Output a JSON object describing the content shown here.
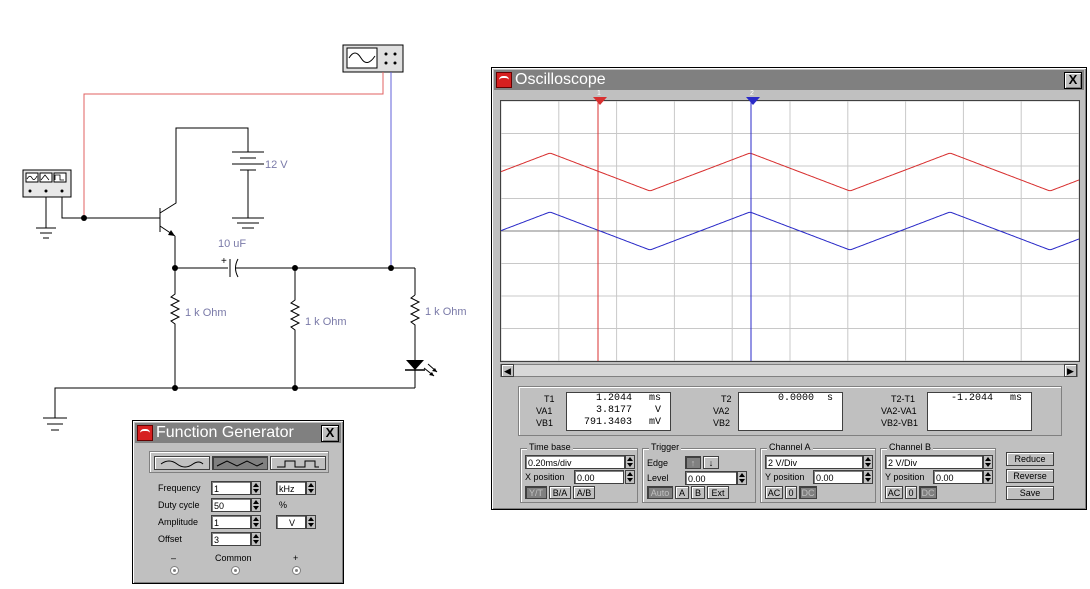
{
  "circuit": {
    "battery_label": "12 V",
    "capacitor_label": "10 uF",
    "resistor_labels": [
      "1 k Ohm",
      "1 k Ohm",
      "1 k Ohm"
    ]
  },
  "function_generator": {
    "title": "Function Generator",
    "close": "X",
    "waveforms": [
      "sine",
      "triangle",
      "square"
    ],
    "selected_waveform": "triangle",
    "frequency": {
      "label": "Frequency",
      "value": "1",
      "unit": "kHz"
    },
    "duty_cycle": {
      "label": "Duty cycle",
      "value": "50",
      "unit": "%"
    },
    "amplitude": {
      "label": "Amplitude",
      "value": "1",
      "unit": "V"
    },
    "offset": {
      "label": "Offset",
      "value": "3"
    },
    "terminals": {
      "minus": "–",
      "common": "Common",
      "plus": "+"
    }
  },
  "oscilloscope": {
    "title": "Oscilloscope",
    "close": "X",
    "cursor1": "1",
    "cursor2": "2",
    "readouts": {
      "t1_label": "T1",
      "va1_label": "VA1",
      "vb1_label": "VB1",
      "t1": "1.2044",
      "t1_unit": "ms",
      "va1": "3.8177",
      "va1_unit": "V",
      "vb1": "791.3403",
      "vb1_unit": "mV",
      "t2_label": "T2",
      "va2_label": "VA2",
      "vb2_label": "VB2",
      "t2": "0.0000",
      "t2_unit": "s",
      "d_label": "T2-T1",
      "dva_label": "VA2-VA1",
      "dvb_label": "VB2-VB1",
      "dt": "-1.2044",
      "dt_unit": "ms"
    },
    "time_base": {
      "title": "Time base",
      "value": "0.20ms/div",
      "xpos_label": "X position",
      "xpos": "0.00",
      "buttons": [
        "Y/T",
        "B/A",
        "A/B"
      ]
    },
    "trigger": {
      "title": "Trigger",
      "edge_label": "Edge",
      "level_label": "Level",
      "level": "0.00",
      "buttons": [
        "Auto",
        "A",
        "B",
        "Ext"
      ]
    },
    "channel_a": {
      "title": "Channel A",
      "value": "2 V/Div",
      "ypos_label": "Y position",
      "ypos": "0.00",
      "buttons": [
        "AC",
        "0",
        "DC"
      ]
    },
    "channel_b": {
      "title": "Channel B",
      "value": "2 V/Div",
      "ypos_label": "Y position",
      "ypos": "0.00",
      "buttons": [
        "AC",
        "0",
        "DC"
      ]
    },
    "side_buttons": [
      "Reduce",
      "Reverse",
      "Save"
    ],
    "colors": {
      "channel_a": "#d83030",
      "channel_b": "#2a2ac8",
      "grid": "#c8c8c8"
    }
  }
}
